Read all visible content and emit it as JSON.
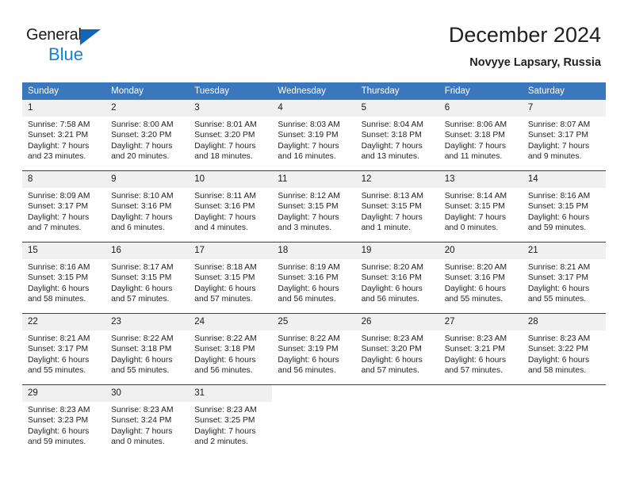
{
  "brand": {
    "name_top": "General",
    "name_bottom": "Blue",
    "accent_color": "#1383d6",
    "triangle_color": "#1266b5"
  },
  "header": {
    "title": "December 2024",
    "subtitle": "Novyye Lapsary, Russia"
  },
  "theme": {
    "header_row_bg": "#3b77bc",
    "daynum_bg": "#f0f0f0",
    "separator_color": "#3f3f3f",
    "text_color": "#1f1f1f"
  },
  "calendar": {
    "weekday_headers": [
      "Sunday",
      "Monday",
      "Tuesday",
      "Wednesday",
      "Thursday",
      "Friday",
      "Saturday"
    ],
    "weeks": [
      [
        {
          "day": "1",
          "sunrise": "Sunrise: 7:58 AM",
          "sunset": "Sunset: 3:21 PM",
          "daylight1": "Daylight: 7 hours",
          "daylight2": "and 23 minutes."
        },
        {
          "day": "2",
          "sunrise": "Sunrise: 8:00 AM",
          "sunset": "Sunset: 3:20 PM",
          "daylight1": "Daylight: 7 hours",
          "daylight2": "and 20 minutes."
        },
        {
          "day": "3",
          "sunrise": "Sunrise: 8:01 AM",
          "sunset": "Sunset: 3:20 PM",
          "daylight1": "Daylight: 7 hours",
          "daylight2": "and 18 minutes."
        },
        {
          "day": "4",
          "sunrise": "Sunrise: 8:03 AM",
          "sunset": "Sunset: 3:19 PM",
          "daylight1": "Daylight: 7 hours",
          "daylight2": "and 16 minutes."
        },
        {
          "day": "5",
          "sunrise": "Sunrise: 8:04 AM",
          "sunset": "Sunset: 3:18 PM",
          "daylight1": "Daylight: 7 hours",
          "daylight2": "and 13 minutes."
        },
        {
          "day": "6",
          "sunrise": "Sunrise: 8:06 AM",
          "sunset": "Sunset: 3:18 PM",
          "daylight1": "Daylight: 7 hours",
          "daylight2": "and 11 minutes."
        },
        {
          "day": "7",
          "sunrise": "Sunrise: 8:07 AM",
          "sunset": "Sunset: 3:17 PM",
          "daylight1": "Daylight: 7 hours",
          "daylight2": "and 9 minutes."
        }
      ],
      [
        {
          "day": "8",
          "sunrise": "Sunrise: 8:09 AM",
          "sunset": "Sunset: 3:17 PM",
          "daylight1": "Daylight: 7 hours",
          "daylight2": "and 7 minutes."
        },
        {
          "day": "9",
          "sunrise": "Sunrise: 8:10 AM",
          "sunset": "Sunset: 3:16 PM",
          "daylight1": "Daylight: 7 hours",
          "daylight2": "and 6 minutes."
        },
        {
          "day": "10",
          "sunrise": "Sunrise: 8:11 AM",
          "sunset": "Sunset: 3:16 PM",
          "daylight1": "Daylight: 7 hours",
          "daylight2": "and 4 minutes."
        },
        {
          "day": "11",
          "sunrise": "Sunrise: 8:12 AM",
          "sunset": "Sunset: 3:15 PM",
          "daylight1": "Daylight: 7 hours",
          "daylight2": "and 3 minutes."
        },
        {
          "day": "12",
          "sunrise": "Sunrise: 8:13 AM",
          "sunset": "Sunset: 3:15 PM",
          "daylight1": "Daylight: 7 hours",
          "daylight2": "and 1 minute."
        },
        {
          "day": "13",
          "sunrise": "Sunrise: 8:14 AM",
          "sunset": "Sunset: 3:15 PM",
          "daylight1": "Daylight: 7 hours",
          "daylight2": "and 0 minutes."
        },
        {
          "day": "14",
          "sunrise": "Sunrise: 8:16 AM",
          "sunset": "Sunset: 3:15 PM",
          "daylight1": "Daylight: 6 hours",
          "daylight2": "and 59 minutes."
        }
      ],
      [
        {
          "day": "15",
          "sunrise": "Sunrise: 8:16 AM",
          "sunset": "Sunset: 3:15 PM",
          "daylight1": "Daylight: 6 hours",
          "daylight2": "and 58 minutes."
        },
        {
          "day": "16",
          "sunrise": "Sunrise: 8:17 AM",
          "sunset": "Sunset: 3:15 PM",
          "daylight1": "Daylight: 6 hours",
          "daylight2": "and 57 minutes."
        },
        {
          "day": "17",
          "sunrise": "Sunrise: 8:18 AM",
          "sunset": "Sunset: 3:15 PM",
          "daylight1": "Daylight: 6 hours",
          "daylight2": "and 57 minutes."
        },
        {
          "day": "18",
          "sunrise": "Sunrise: 8:19 AM",
          "sunset": "Sunset: 3:16 PM",
          "daylight1": "Daylight: 6 hours",
          "daylight2": "and 56 minutes."
        },
        {
          "day": "19",
          "sunrise": "Sunrise: 8:20 AM",
          "sunset": "Sunset: 3:16 PM",
          "daylight1": "Daylight: 6 hours",
          "daylight2": "and 56 minutes."
        },
        {
          "day": "20",
          "sunrise": "Sunrise: 8:20 AM",
          "sunset": "Sunset: 3:16 PM",
          "daylight1": "Daylight: 6 hours",
          "daylight2": "and 55 minutes."
        },
        {
          "day": "21",
          "sunrise": "Sunrise: 8:21 AM",
          "sunset": "Sunset: 3:17 PM",
          "daylight1": "Daylight: 6 hours",
          "daylight2": "and 55 minutes."
        }
      ],
      [
        {
          "day": "22",
          "sunrise": "Sunrise: 8:21 AM",
          "sunset": "Sunset: 3:17 PM",
          "daylight1": "Daylight: 6 hours",
          "daylight2": "and 55 minutes."
        },
        {
          "day": "23",
          "sunrise": "Sunrise: 8:22 AM",
          "sunset": "Sunset: 3:18 PM",
          "daylight1": "Daylight: 6 hours",
          "daylight2": "and 55 minutes."
        },
        {
          "day": "24",
          "sunrise": "Sunrise: 8:22 AM",
          "sunset": "Sunset: 3:18 PM",
          "daylight1": "Daylight: 6 hours",
          "daylight2": "and 56 minutes."
        },
        {
          "day": "25",
          "sunrise": "Sunrise: 8:22 AM",
          "sunset": "Sunset: 3:19 PM",
          "daylight1": "Daylight: 6 hours",
          "daylight2": "and 56 minutes."
        },
        {
          "day": "26",
          "sunrise": "Sunrise: 8:23 AM",
          "sunset": "Sunset: 3:20 PM",
          "daylight1": "Daylight: 6 hours",
          "daylight2": "and 57 minutes."
        },
        {
          "day": "27",
          "sunrise": "Sunrise: 8:23 AM",
          "sunset": "Sunset: 3:21 PM",
          "daylight1": "Daylight: 6 hours",
          "daylight2": "and 57 minutes."
        },
        {
          "day": "28",
          "sunrise": "Sunrise: 8:23 AM",
          "sunset": "Sunset: 3:22 PM",
          "daylight1": "Daylight: 6 hours",
          "daylight2": "and 58 minutes."
        }
      ],
      [
        {
          "day": "29",
          "sunrise": "Sunrise: 8:23 AM",
          "sunset": "Sunset: 3:23 PM",
          "daylight1": "Daylight: 6 hours",
          "daylight2": "and 59 minutes."
        },
        {
          "day": "30",
          "sunrise": "Sunrise: 8:23 AM",
          "sunset": "Sunset: 3:24 PM",
          "daylight1": "Daylight: 7 hours",
          "daylight2": "and 0 minutes."
        },
        {
          "day": "31",
          "sunrise": "Sunrise: 8:23 AM",
          "sunset": "Sunset: 3:25 PM",
          "daylight1": "Daylight: 7 hours",
          "daylight2": "and 2 minutes."
        },
        {
          "day": "",
          "sunrise": "",
          "sunset": "",
          "daylight1": "",
          "daylight2": ""
        },
        {
          "day": "",
          "sunrise": "",
          "sunset": "",
          "daylight1": "",
          "daylight2": ""
        },
        {
          "day": "",
          "sunrise": "",
          "sunset": "",
          "daylight1": "",
          "daylight2": ""
        },
        {
          "day": "",
          "sunrise": "",
          "sunset": "",
          "daylight1": "",
          "daylight2": ""
        }
      ]
    ]
  }
}
